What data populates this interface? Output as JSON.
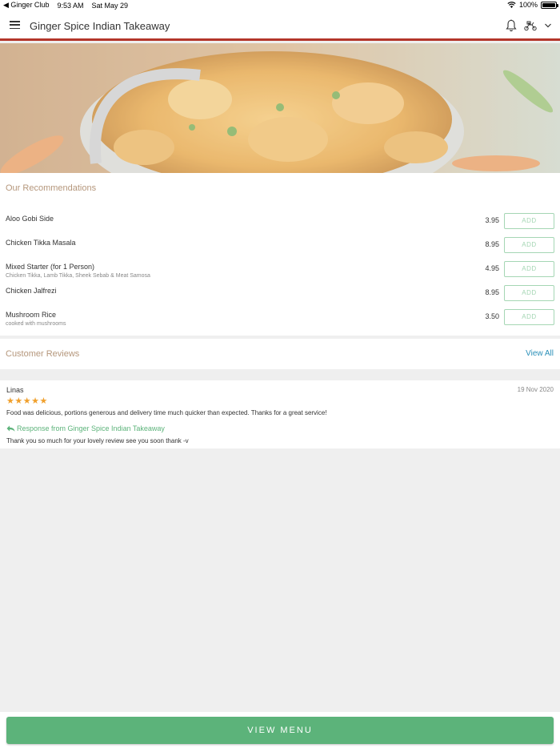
{
  "status_bar": {
    "back_app": "◀ Ginger Club",
    "time": "9:53 AM",
    "date": "Sat May 29",
    "battery": "100%"
  },
  "nav": {
    "title": "Ginger Spice Indian Takeaway"
  },
  "recommendations": {
    "title": "Our Recommendations",
    "add_label": "ADD",
    "items": [
      {
        "name": "Aloo Gobi Side",
        "description": "",
        "price": "3.95"
      },
      {
        "name": "Chicken Tikka Masala",
        "description": "",
        "price": "8.95"
      },
      {
        "name": "Mixed Starter (for 1 Person)",
        "description": "Chicken Tikka, Lamb Tikka, Sheek Sebab & Meat Samosa",
        "price": "4.95"
      },
      {
        "name": "Chicken Jalfrezi",
        "description": "",
        "price": "8.95"
      },
      {
        "name": "Mushroom Rice",
        "description": "cooked with mushrooms",
        "price": "3.50"
      }
    ]
  },
  "reviews": {
    "title": "Customer Reviews",
    "view_all": "View All",
    "items": [
      {
        "reviewer": "Linas",
        "date": "19 Nov 2020",
        "rating": 5,
        "stars": "★★★★★",
        "text": "Food was delicious, portions generous and delivery time much quicker than expected.  Thanks for a great service!",
        "response_label": "Response from Ginger Spice Indian Takeaway",
        "response_text": "Thank you so much for your lovely review see you soon thank -v"
      }
    ]
  },
  "bottom": {
    "view_menu": "VIEW MENU"
  },
  "colors": {
    "accent_green": "#5cb37a",
    "header_underline": "#b3362a",
    "section_title": "#b5977c",
    "link_blue": "#2a8fb8",
    "star": "#f0a02c"
  }
}
